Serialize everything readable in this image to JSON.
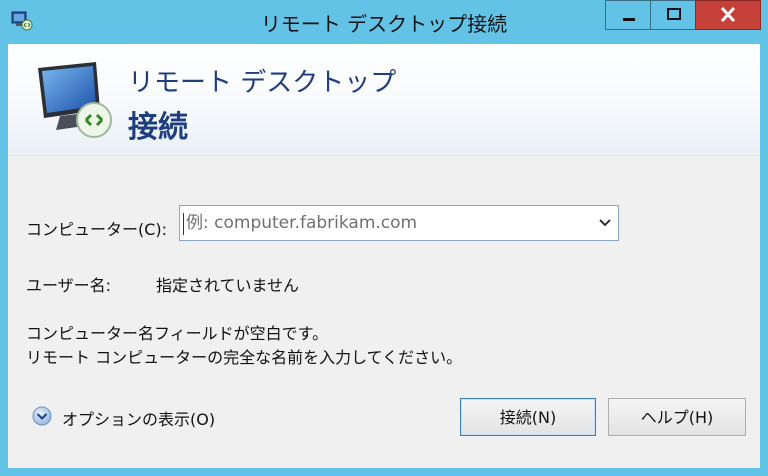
{
  "window": {
    "title": "リモート デスクトップ接続"
  },
  "header": {
    "line1": "リモート デスクトップ",
    "line2": "接続"
  },
  "form": {
    "computer_label": "コンピューター(C):",
    "computer_placeholder": "例: computer.fabrikam.com",
    "user_label": "ユーザー名:",
    "user_value": "指定されていません",
    "message_line1": "コンピューター名フィールドが空白です。",
    "message_line2": "リモート コンピューターの完全な名前を入力してください。"
  },
  "options": {
    "label": "オプションの表示(O)"
  },
  "buttons": {
    "connect": "接続(N)",
    "help": "ヘルプ(H)"
  },
  "colors": {
    "titlebar": "#62c3e7",
    "close": "#c6403a",
    "brand": "#1f3e7e"
  }
}
